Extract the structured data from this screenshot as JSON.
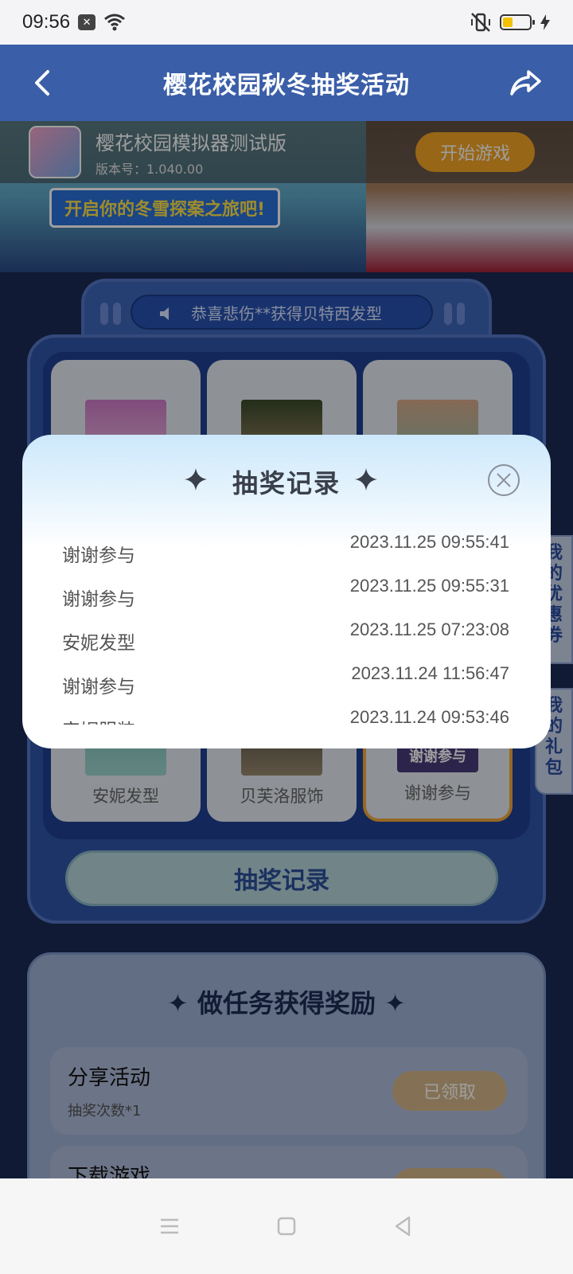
{
  "status_bar": {
    "time": "09:56"
  },
  "header": {
    "title": "樱花校园秋冬抽奖活动"
  },
  "banner": {
    "app_name": "樱花校园模拟器测试版",
    "app_version": "版本号：1.040.00",
    "start_label": "开始游戏",
    "slogan": "开启你的冬雪探案之旅吧!"
  },
  "lottery": {
    "marquee": "恭喜悲伤**获得贝特西发型",
    "cells_bottom": [
      "安妮发型",
      "贝芙洛服饰",
      "谢谢参与"
    ],
    "badge_text": "谢谢参与",
    "record_button": "抽奖记录"
  },
  "side_tabs": {
    "coupons": "我的优惠券",
    "gifts": "我的礼包"
  },
  "tasks": {
    "title": "做任务获得奖励",
    "items": [
      {
        "name": "分享活动",
        "desc": "抽奖次数*1",
        "action": "已领取"
      },
      {
        "name": "下载游戏",
        "desc": "",
        "action": ""
      }
    ]
  },
  "modal": {
    "title": "抽奖记录",
    "records": [
      {
        "prize": "谢谢参与",
        "time": "2023.11.25 09:55:41"
      },
      {
        "prize": "谢谢参与",
        "time": "2023.11.25 09:55:31"
      },
      {
        "prize": "安妮发型",
        "time": "2023.11.25 07:23:08"
      },
      {
        "prize": "谢谢参与",
        "time": "2023.11.24 11:56:47"
      },
      {
        "prize": "安妮服装",
        "time": "2023.11.24 09:53:46"
      }
    ]
  },
  "colors": {
    "header": "#3a5ea8",
    "accent_orange": "#f4a524",
    "modal_title": "#3a3f4c"
  }
}
